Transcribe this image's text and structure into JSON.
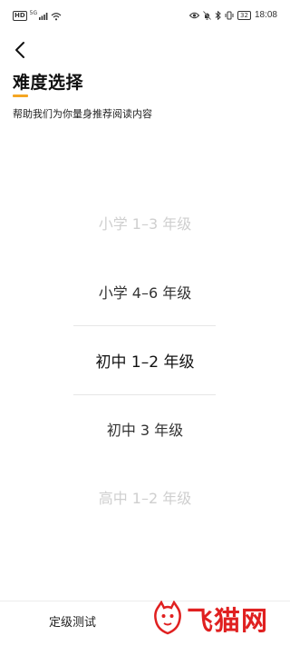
{
  "status_bar": {
    "hd_label": "HD",
    "network_label": "5G",
    "battery_level": "32",
    "time": "18:08",
    "icons": [
      "signal-icon",
      "wifi-icon",
      "eye-icon",
      "alarm-off-icon",
      "bluetooth-icon",
      "vibrate-icon",
      "battery-icon"
    ]
  },
  "header": {
    "back_icon": "chevron-left-icon",
    "title": "难度选择",
    "subtitle": "帮助我们为你量身推荐阅读内容"
  },
  "picker": {
    "items": [
      "小学 1–3 年级",
      "小学 4–6 年级",
      "初中 1–2 年级",
      "初中 3 年级",
      "高中 1–2 年级"
    ],
    "selected_index": 2
  },
  "bottom": {
    "level_test_label": "定级测试"
  },
  "watermark": {
    "text": "飞猫网"
  },
  "colors": {
    "accent": "#f5a623",
    "watermark": "#e02020",
    "faded_text": "#cfcfcf"
  }
}
